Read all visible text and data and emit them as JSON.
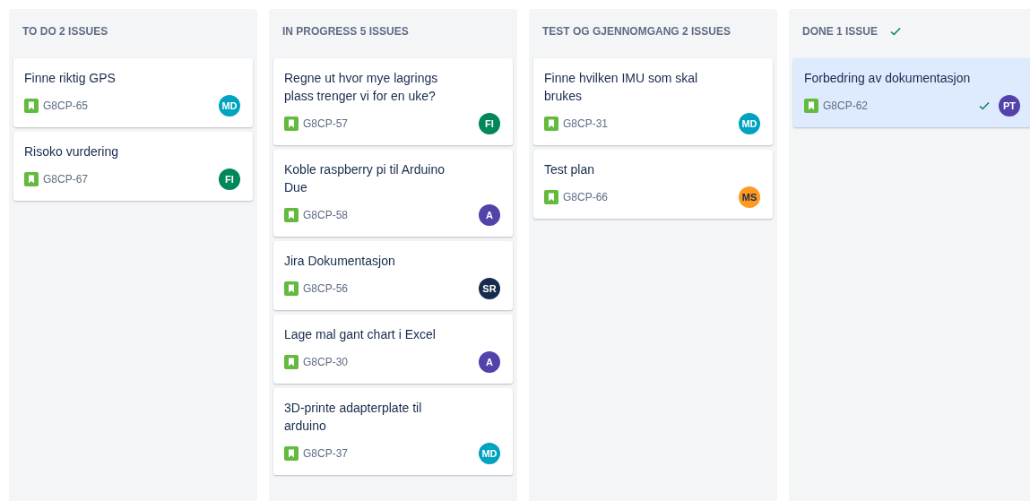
{
  "columns": [
    {
      "title": "TO DO 2 ISSUES",
      "done": false,
      "issues": [
        {
          "summary": "Finne riktig GPS",
          "key": "G8CP-65",
          "assignee": {
            "initials": "MD",
            "color": "#00a3bf"
          },
          "selected": false,
          "resolved": false
        },
        {
          "summary": "Risoko vurdering",
          "key": "G8CP-67",
          "assignee": {
            "initials": "FI",
            "color": "#00875a"
          },
          "selected": false,
          "resolved": false
        }
      ]
    },
    {
      "title": "IN PROGRESS 5 ISSUES",
      "done": false,
      "issues": [
        {
          "summary": "Regne ut hvor mye lagrings plass trenger vi for en uke?",
          "key": "G8CP-57",
          "assignee": {
            "initials": "FI",
            "color": "#00875a"
          },
          "selected": false,
          "resolved": false
        },
        {
          "summary": "Koble raspberry pi til Arduino Due",
          "key": "G8CP-58",
          "assignee": {
            "initials": "A",
            "color": "#5243aa"
          },
          "selected": false,
          "resolved": false
        },
        {
          "summary": "Jira Dokumentasjon",
          "key": "G8CP-56",
          "assignee": {
            "initials": "SR",
            "color": "#172b4d"
          },
          "selected": false,
          "resolved": false
        },
        {
          "summary": "Lage mal gant chart i Excel",
          "key": "G8CP-30",
          "assignee": {
            "initials": "A",
            "color": "#5243aa"
          },
          "selected": false,
          "resolved": false
        },
        {
          "summary": "3D-printe adapterplate til arduino",
          "key": "G8CP-37",
          "assignee": {
            "initials": "MD",
            "color": "#00a3bf"
          },
          "selected": false,
          "resolved": false
        }
      ]
    },
    {
      "title": "TEST OG GJENNOMGANG 2 ISSUES",
      "done": false,
      "issues": [
        {
          "summary": "Finne hvilken IMU som skal brukes",
          "key": "G8CP-31",
          "assignee": {
            "initials": "MD",
            "color": "#00a3bf"
          },
          "selected": false,
          "resolved": false
        },
        {
          "summary": "Test plan",
          "key": "G8CP-66",
          "assignee": {
            "initials": "MS",
            "color": "#ff991f"
          },
          "selected": false,
          "resolved": false
        }
      ]
    },
    {
      "title": "DONE 1 ISSUE",
      "done": true,
      "issues": [
        {
          "summary": "Forbedring av dokumentasjon",
          "key": "G8CP-62",
          "assignee": {
            "initials": "PT",
            "color": "#5243aa"
          },
          "selected": true,
          "resolved": true
        }
      ]
    }
  ]
}
